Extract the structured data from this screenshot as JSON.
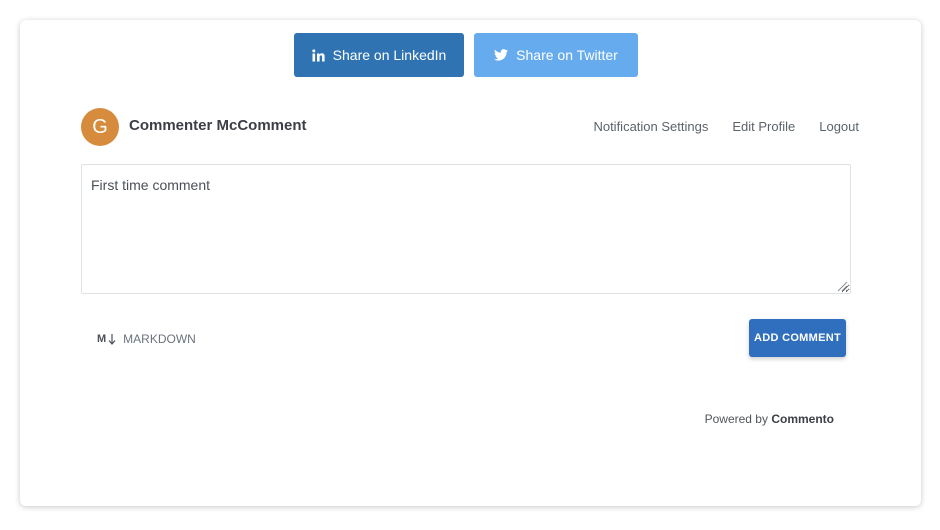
{
  "share": {
    "linkedin_label": "Share on LinkedIn",
    "linkedin_icon": "linkedin-icon",
    "linkedin_color": "#2f73b3",
    "twitter_label": "Share on Twitter",
    "twitter_icon": "twitter-icon",
    "twitter_color": "#65abee"
  },
  "user": {
    "avatar_initial": "G",
    "avatar_color": "#d78b3d",
    "name": "Commenter McComment",
    "links": {
      "notification_settings": "Notification Settings",
      "edit_profile": "Edit Profile",
      "logout": "Logout"
    }
  },
  "comment": {
    "value": "First time comment"
  },
  "markdown": {
    "icon_text": "M",
    "label": "MARKDOWN"
  },
  "actions": {
    "add_comment_label": "ADD COMMENT",
    "add_comment_color": "#2f6fbd"
  },
  "footer": {
    "powered_prefix": "Powered by",
    "powered_brand": "Commento"
  }
}
